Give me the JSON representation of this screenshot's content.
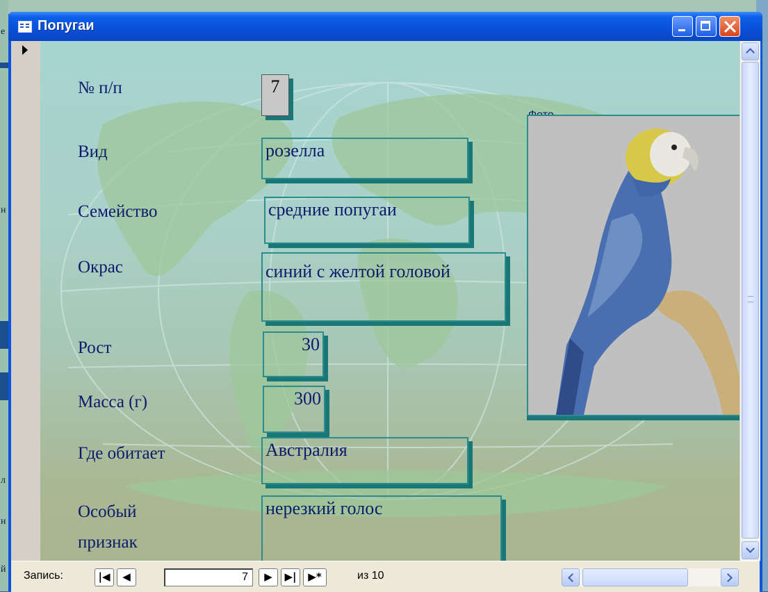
{
  "window": {
    "title": "Попугаи"
  },
  "form": {
    "fields": [
      {
        "label": "№ п/п",
        "value": "7"
      },
      {
        "label": "Вид",
        "value": "розелла"
      },
      {
        "label": "Семейство",
        "value": "средние попугаи"
      },
      {
        "label": "Окрас",
        "value": "синий с желтой головой"
      },
      {
        "label": "Рост",
        "value": "30"
      },
      {
        "label": "Масса (г)",
        "value": "300"
      },
      {
        "label": "Где обитает",
        "value": "Австралия"
      },
      {
        "label": "Особый признак",
        "value": "нерезкий голос"
      }
    ],
    "photo_label": "Фото"
  },
  "nav": {
    "label": "Запись:",
    "current": "7",
    "of_text": "из  10",
    "buttons": {
      "first": "|◀",
      "prev": "◀",
      "next": "▶",
      "last": "▶|",
      "new": "▶*"
    }
  },
  "background": {
    "left_texts": [
      "е",
      "н",
      "л",
      "н",
      "й"
    ]
  },
  "colors": {
    "title_bar": "#0a54e0",
    "label_text": "#0e1a6b",
    "field_border": "#2a8c8c",
    "close_button": "#d8441c"
  },
  "icons": [
    "form-icon",
    "minimize-icon",
    "maximize-icon",
    "close-icon",
    "record-selector-icon",
    "scroll-up-icon",
    "scroll-down-icon",
    "scroll-left-icon",
    "scroll-right-icon"
  ]
}
